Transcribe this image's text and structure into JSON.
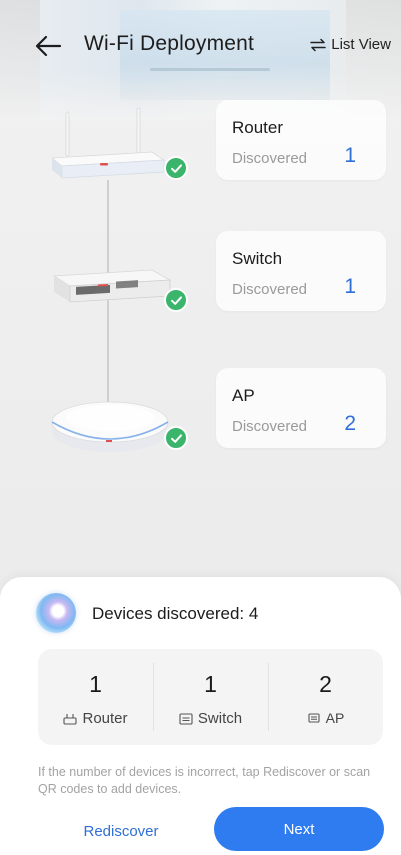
{
  "header": {
    "title": "Wi-Fi Deployment",
    "list_view_label": "List View"
  },
  "devices": [
    {
      "name": "Router",
      "status": "Discovered",
      "count": "1",
      "icon": "router-device-icon"
    },
    {
      "name": "Switch",
      "status": "Discovered",
      "count": "1",
      "icon": "switch-device-icon"
    },
    {
      "name": "AP",
      "status": "Discovered",
      "count": "2",
      "icon": "access-point-device-icon"
    }
  ],
  "sheet": {
    "discovered_text": "Devices discovered: 4",
    "summary": [
      {
        "count": "1",
        "label": "Router",
        "icon": "router-icon"
      },
      {
        "count": "1",
        "label": "Switch",
        "icon": "switch-icon"
      },
      {
        "count": "2",
        "label": "AP",
        "icon": "ap-icon"
      }
    ],
    "hint": "If the number of devices is incorrect, tap Rediscover or scan QR codes to add devices.",
    "rediscover_label": "Rediscover",
    "next_label": "Next"
  },
  "colors": {
    "accent": "#2f7bf0",
    "count_blue": "#2f6fd6",
    "check_green": "#3bb56c"
  }
}
